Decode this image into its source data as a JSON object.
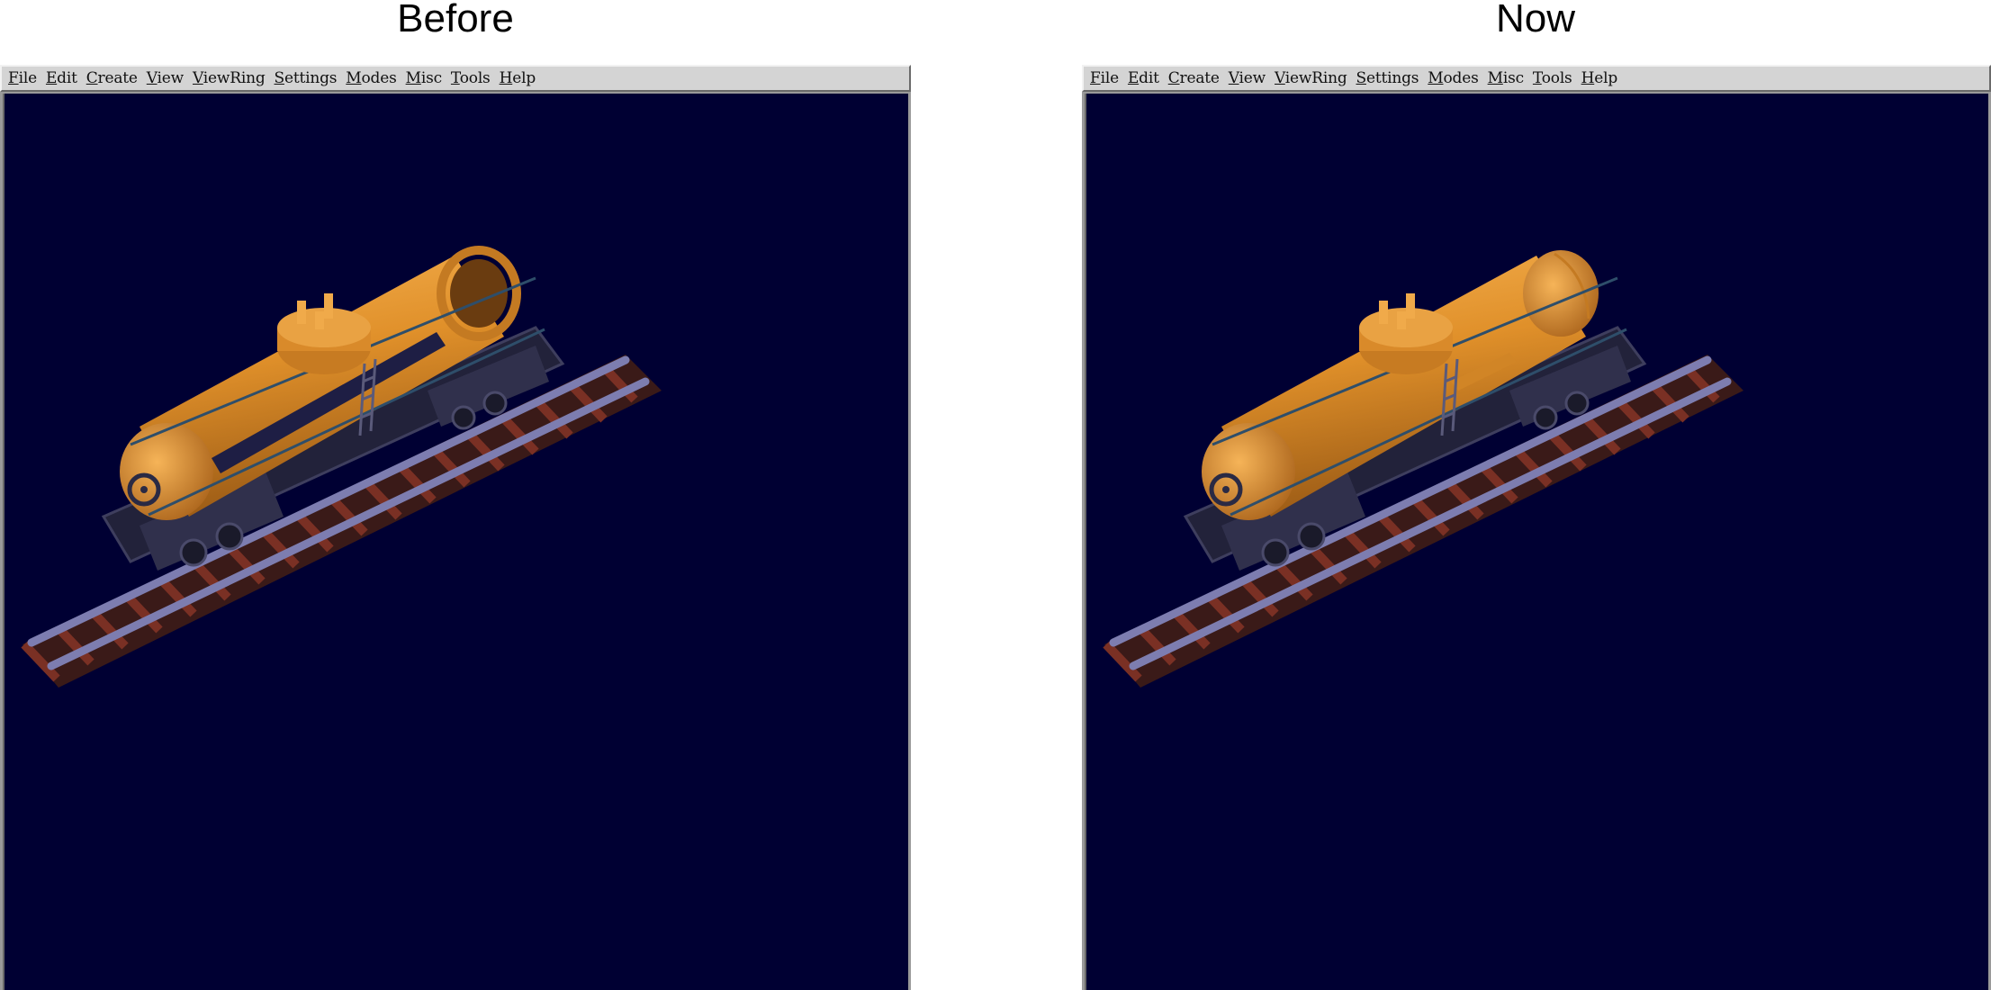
{
  "panels": {
    "before": {
      "title": "Before",
      "menu": [
        "File",
        "Edit",
        "Create",
        "View",
        "ViewRing",
        "Settings",
        "Modes",
        "Misc",
        "Tools",
        "Help"
      ]
    },
    "now": {
      "title": "Now",
      "menu": [
        "File",
        "Edit",
        "Create",
        "View",
        "ViewRing",
        "Settings",
        "Modes",
        "Misc",
        "Tools",
        "Help"
      ]
    }
  },
  "colors": {
    "viewport_background": "#000033",
    "tank": "#e0902a",
    "tank_shadow": "#9a5a15",
    "rail": "#6b6b9a",
    "tie": "#6a2a20",
    "frame": "#2a2a44"
  }
}
